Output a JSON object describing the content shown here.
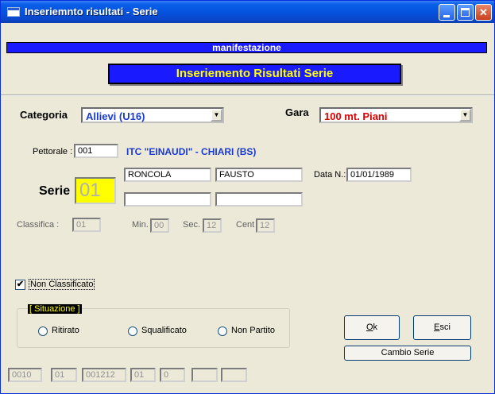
{
  "window": {
    "title": "Inseriemnto risultati  -  Serie",
    "controls": {
      "minimize": "minimize",
      "maximize": "maximize",
      "close": "✕"
    }
  },
  "manifestation_label": "manifestazione",
  "header_title": "Inseriemento Risultati Serie",
  "categoria": {
    "label": "Categoria",
    "value": "Allievi (U16)",
    "color": "#1a3ad0"
  },
  "gara": {
    "label": "Gara",
    "value": "100 mt. Piani",
    "color": "#e00000"
  },
  "pettorale": {
    "label": "Pettorale :",
    "value": "001"
  },
  "school": "ITC \"EINAUDI\" - CHIARI (BS)",
  "athlete": {
    "cognome": "RONCOLA",
    "nome": "FAUSTO",
    "extra1": "",
    "extra2": ""
  },
  "data_nascita": {
    "label": "Data N.:",
    "value": "01/01/1989"
  },
  "serie": {
    "label": "Serie",
    "value": "01"
  },
  "classifica": {
    "label": "Classifica :",
    "value": "01"
  },
  "tempo": {
    "min_label": "Min.",
    "min_value": "00",
    "sec_label": "Sec.",
    "sec_value": "12",
    "cent_label": "Cent",
    "cent_value": "12"
  },
  "non_classificato": {
    "label": "Non Classificato",
    "checked": true,
    "mark": "✔"
  },
  "situazione": {
    "title": "[ Situazione ]",
    "options": [
      "Ritirato",
      "Squalificato",
      "Non Partito"
    ]
  },
  "buttons": {
    "ok": "Ok",
    "ok_mnemonic": "O",
    "esci": "Esci",
    "esci_mnemonic": "E",
    "cambio_serie": "Cambio Serie"
  },
  "status_fields": [
    "0010",
    "01",
    "001212",
    "01",
    "0",
    "",
    ""
  ]
}
